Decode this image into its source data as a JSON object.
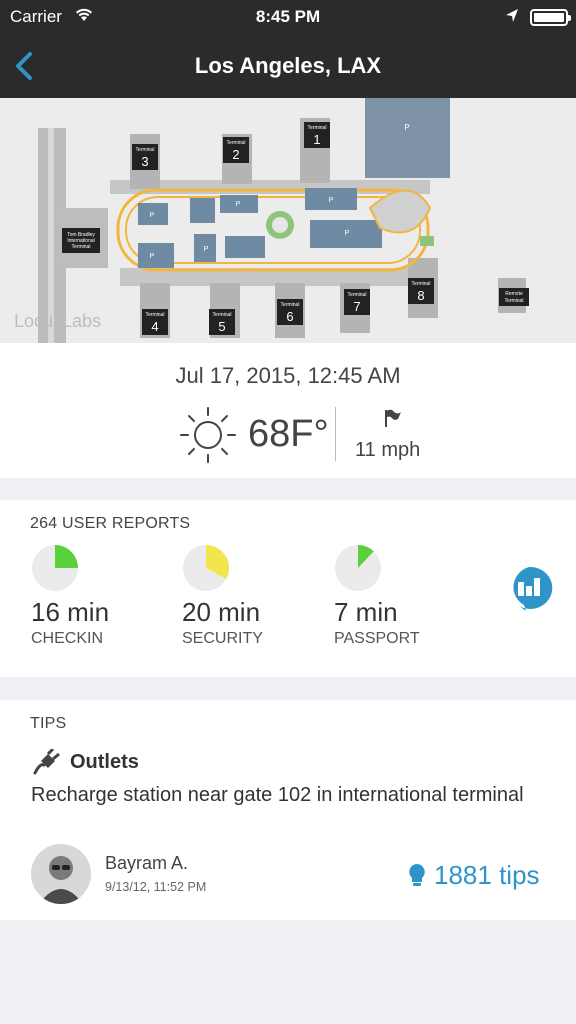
{
  "status_bar": {
    "carrier": "Carrier",
    "time": "8:45 PM",
    "icons": [
      "wifi-icon",
      "location-arrow-icon",
      "battery-icon"
    ]
  },
  "nav": {
    "title": "Los Angeles, LAX",
    "back_icon": "chevron-left-icon"
  },
  "map": {
    "brand": "LocusLabs",
    "terminal_prefix": "Terminal",
    "terminals": [
      "1",
      "2",
      "3",
      "4",
      "5",
      "6",
      "7",
      "8"
    ],
    "international_terminal": [
      "Tom Bradley",
      "International",
      "Terminal"
    ],
    "remote_terminal": [
      "Remote",
      "Terminal"
    ],
    "parking_label": "P"
  },
  "weather": {
    "datetime": "Jul 17, 2015, 12:45 AM",
    "temperature": "68F°",
    "wind": "11 mph",
    "condition_icon": "sun-icon",
    "wind_icon": "flag-icon"
  },
  "reports": {
    "heading": "264 USER REPORTS",
    "items": [
      {
        "minutes": "16 min",
        "label": "CHECKIN",
        "fraction": 0.25,
        "color": "#5ad13a"
      },
      {
        "minutes": "20 min",
        "label": "SECURITY",
        "fraction": 0.33,
        "color": "#f2e64c"
      },
      {
        "minutes": "7 min",
        "label": "PASSPORT",
        "fraction": 0.12,
        "color": "#5ad13a"
      }
    ],
    "report_button_icon": "chart-bubble-icon",
    "accent_color": "#2f95c8"
  },
  "tips": {
    "heading": "TIPS",
    "category": "Outlets",
    "category_icon": "plug-icon",
    "text": "Recharge station near gate 102 in international terminal",
    "author": "Bayram A.",
    "timestamp": "9/13/12, 11:52 PM",
    "count_label": "1881 tips",
    "count_icon": "lightbulb-icon"
  }
}
